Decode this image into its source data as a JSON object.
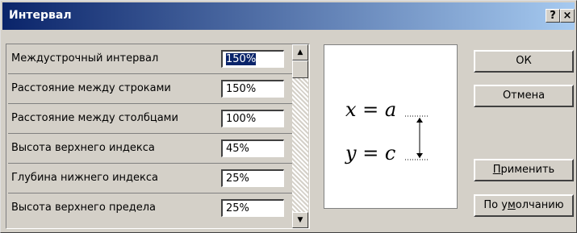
{
  "dialog": {
    "title": "Интервал",
    "help_button": "?",
    "close_button": "×"
  },
  "rows": [
    {
      "label": "Междустрочный интервал",
      "value": "150%",
      "selected": true
    },
    {
      "label": "Расстояние между строками",
      "value": "150%"
    },
    {
      "label": "Расстояние между столбцами",
      "value": "100%"
    },
    {
      "label": "Высота верхнего индекса",
      "value": "45%"
    },
    {
      "label": "Глубина нижнего индекса",
      "value": "25%"
    },
    {
      "label": "Высота верхнего предела",
      "value": "25%"
    }
  ],
  "preview": {
    "line1": "x = a",
    "line2": "y = c"
  },
  "buttons": {
    "ok": "ОК",
    "cancel": "Отмена",
    "apply_pre": "",
    "apply_mn": "П",
    "apply_post": "рименить",
    "default_pre": "По у",
    "default_mn": "м",
    "default_post": "олчанию"
  },
  "icons": {
    "scroll_up": "scroll-up-arrow-icon",
    "scroll_down": "scroll-down-arrow-icon"
  }
}
